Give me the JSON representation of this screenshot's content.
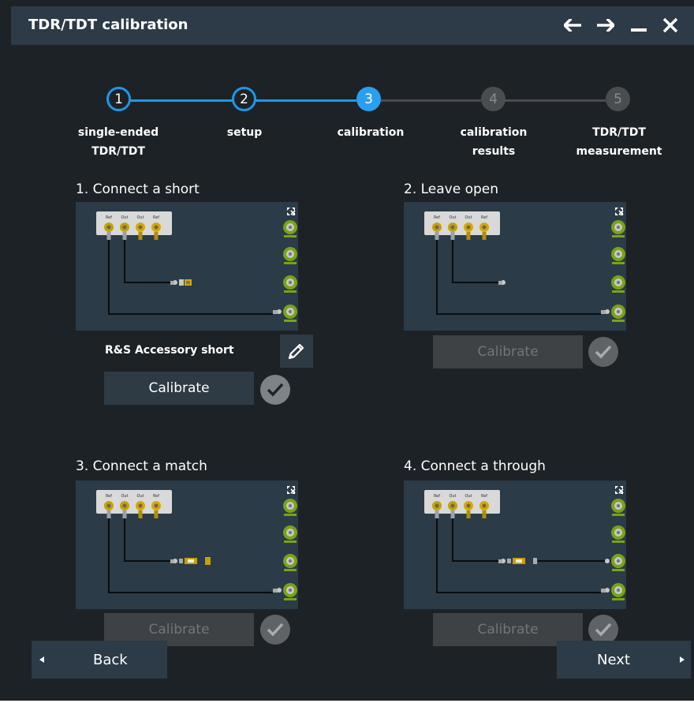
{
  "window": {
    "title": "TDR/TDT calibration"
  },
  "titlebar_icons": [
    "back-arrow-icon",
    "forward-arrow-icon",
    "minimize-icon",
    "close-icon"
  ],
  "colors": {
    "accent": "#2a9ff0",
    "title_bar": "#2d3a47",
    "background": "#1d2226",
    "panel": "#2b3b47"
  },
  "steps": [
    {
      "number": "1",
      "label": "single-ended\nTDR/TDT",
      "state": "done"
    },
    {
      "number": "2",
      "label": "setup",
      "state": "done"
    },
    {
      "number": "3",
      "label": "calibration",
      "state": "active"
    },
    {
      "number": "4",
      "label": "calibration\nresults",
      "state": "future"
    },
    {
      "number": "5",
      "label": "TDR/TDT\nmeasurement",
      "state": "future"
    }
  ],
  "sections": [
    {
      "title": "1. Connect a short",
      "device_label": "R&S Accessory short",
      "button": "Calibrate",
      "enabled": true
    },
    {
      "title": "2. Leave open",
      "button": "Calibrate",
      "enabled": false
    },
    {
      "title": "3. Connect a match",
      "button": "Calibrate",
      "enabled": false
    },
    {
      "title": "4. Connect a through",
      "button": "Calibrate",
      "enabled": false
    }
  ],
  "connector_labels": [
    "Ref",
    "Out",
    "Out",
    "Ref"
  ],
  "footer": {
    "back": "Back",
    "next": "Next"
  }
}
